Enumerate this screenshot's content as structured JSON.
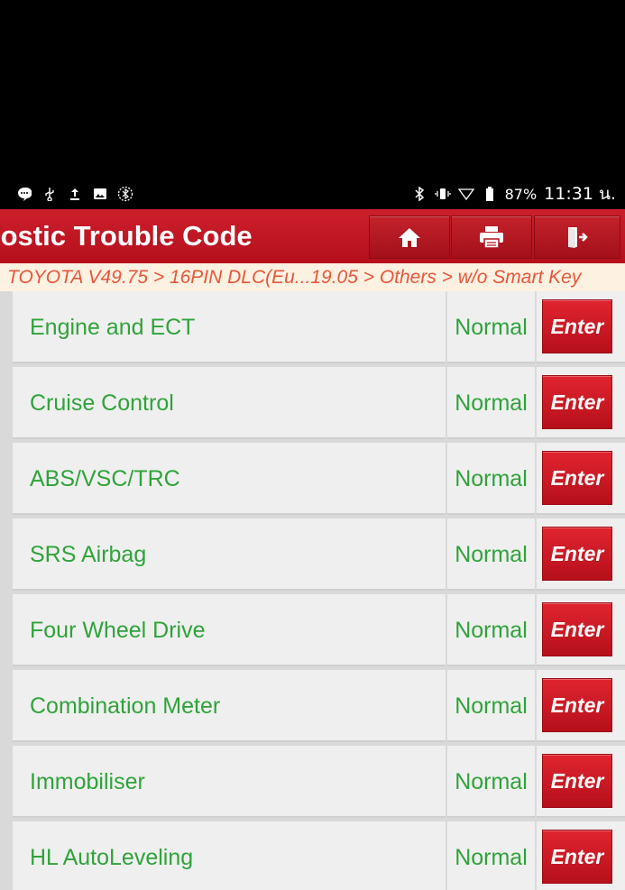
{
  "status_bar": {
    "left_icons": [
      "chat-bubble-icon",
      "usb-icon",
      "upload-icon",
      "image-icon",
      "bluetooth-circle-icon"
    ],
    "right_icons": [
      "bluetooth-icon",
      "vibrate-icon",
      "wifi-icon",
      "battery-icon"
    ],
    "battery_percent": "87%",
    "time": "11:31 น."
  },
  "header": {
    "title": "ıostic Trouble Code",
    "buttons": [
      {
        "icon": "home-icon"
      },
      {
        "icon": "printer-icon"
      },
      {
        "icon": "exit-icon"
      }
    ],
    "accent_color": "#c41a27"
  },
  "breadcrumb": {
    "text": "TOYOTA V49.75 > 16PIN DLC(Eu...19.05 > Others > w/o Smart Key"
  },
  "systems": {
    "rows": [
      {
        "name": "Engine and ECT",
        "status": "Normal",
        "action": "Enter"
      },
      {
        "name": "Cruise Control",
        "status": "Normal",
        "action": "Enter"
      },
      {
        "name": "ABS/VSC/TRC",
        "status": "Normal",
        "action": "Enter"
      },
      {
        "name": "SRS Airbag",
        "status": "Normal",
        "action": "Enter"
      },
      {
        "name": "Four Wheel Drive",
        "status": "Normal",
        "action": "Enter"
      },
      {
        "name": "Combination Meter",
        "status": "Normal",
        "action": "Enter"
      },
      {
        "name": "Immobiliser",
        "status": "Normal",
        "action": "Enter"
      },
      {
        "name": "HL AutoLeveling",
        "status": "Normal",
        "action": "Enter"
      }
    ],
    "text_color": "#2fa33a"
  }
}
